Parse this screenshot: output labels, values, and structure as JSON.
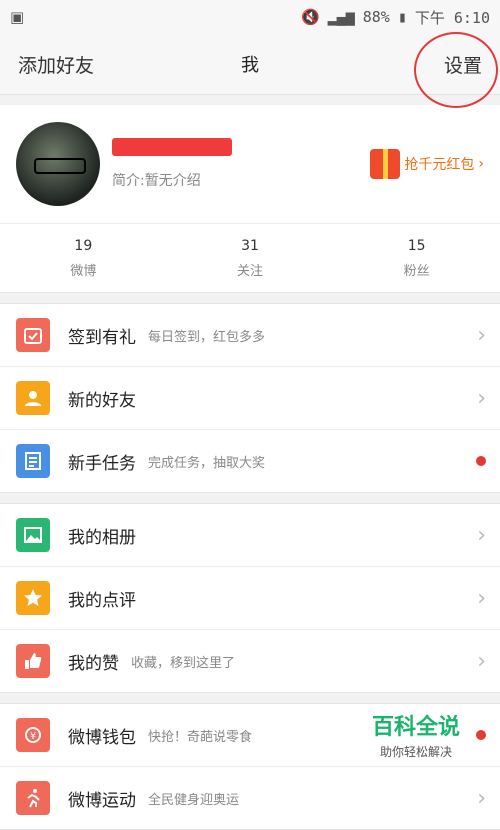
{
  "status": {
    "battery": "88%",
    "time": "下午 6:10"
  },
  "nav": {
    "left": "添加好友",
    "title": "我",
    "right": "设置"
  },
  "profile": {
    "bio": "简介:暂无介绍",
    "bonus": "抢千元红包"
  },
  "stats": [
    {
      "num": "19",
      "label": "微博"
    },
    {
      "num": "31",
      "label": "关注"
    },
    {
      "num": "15",
      "label": "粉丝"
    }
  ],
  "sections": [
    [
      {
        "title": "签到有礼",
        "sub": "每日签到，红包多多",
        "icon": "calendar-icon",
        "color": "#f06a5a",
        "end": "chevron"
      },
      {
        "title": "新的好友",
        "sub": "",
        "icon": "user-icon",
        "color": "#f7a51a",
        "end": "chevron"
      },
      {
        "title": "新手任务",
        "sub": "完成任务，抽取大奖",
        "icon": "task-icon",
        "color": "#4a90e2",
        "end": "dot"
      }
    ],
    [
      {
        "title": "我的相册",
        "sub": "",
        "icon": "photo-icon",
        "color": "#2bb673",
        "end": "chevron"
      },
      {
        "title": "我的点评",
        "sub": "",
        "icon": "star-icon",
        "color": "#f7a51a",
        "end": "chevron"
      },
      {
        "title": "我的赞",
        "sub": "收藏，移到这里了",
        "icon": "thumbs-up-icon",
        "color": "#f06a5a",
        "end": "chevron"
      }
    ],
    [
      {
        "title": "微博钱包",
        "sub": "快抢！奇葩说零食",
        "icon": "wallet-icon",
        "color": "#f06a5a",
        "end": "dot"
      },
      {
        "title": "微博运动",
        "sub": "全民健身迎奥运",
        "icon": "run-icon",
        "color": "#f06a5a",
        "end": "chevron"
      }
    ]
  ],
  "watermark": {
    "big": "百科全说",
    "small": "助你轻松解决"
  }
}
